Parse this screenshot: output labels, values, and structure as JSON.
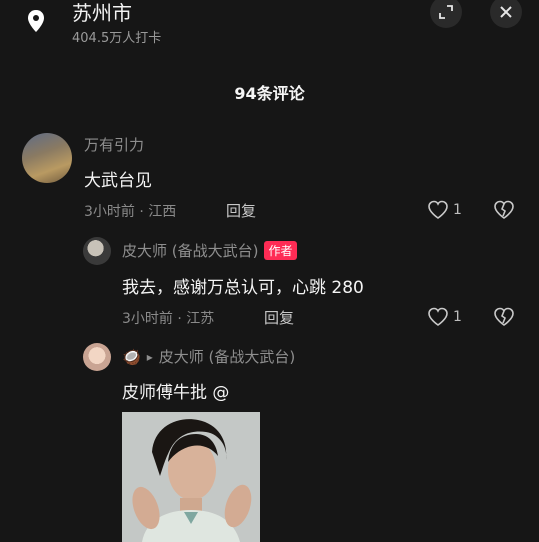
{
  "header": {
    "location_title": "苏州市",
    "location_subtitle": "404.5万人打卡",
    "icons": [
      "location-pin-icon",
      "expand-icon",
      "close-icon"
    ]
  },
  "comment_count": "94条评论",
  "comments": [
    {
      "username": "万有引力",
      "text": "大武台见",
      "meta": "3小时前 · 江西",
      "reply_label": "回复",
      "likes": "1"
    },
    {
      "username": "皮大师 (备战大武台)",
      "badge": "作者",
      "text": "我去，感谢万总认可，心跳 280",
      "meta": "3小时前 · 江苏",
      "reply_label": "回复",
      "likes": "1"
    },
    {
      "username_prefix_emoji": "🥥",
      "reply_arrow": "▸",
      "username": "皮大师 (备战大武台)",
      "text": "皮师傅牛批 @"
    }
  ],
  "colors": {
    "background": "#161616",
    "badge": "#fe2c55"
  }
}
